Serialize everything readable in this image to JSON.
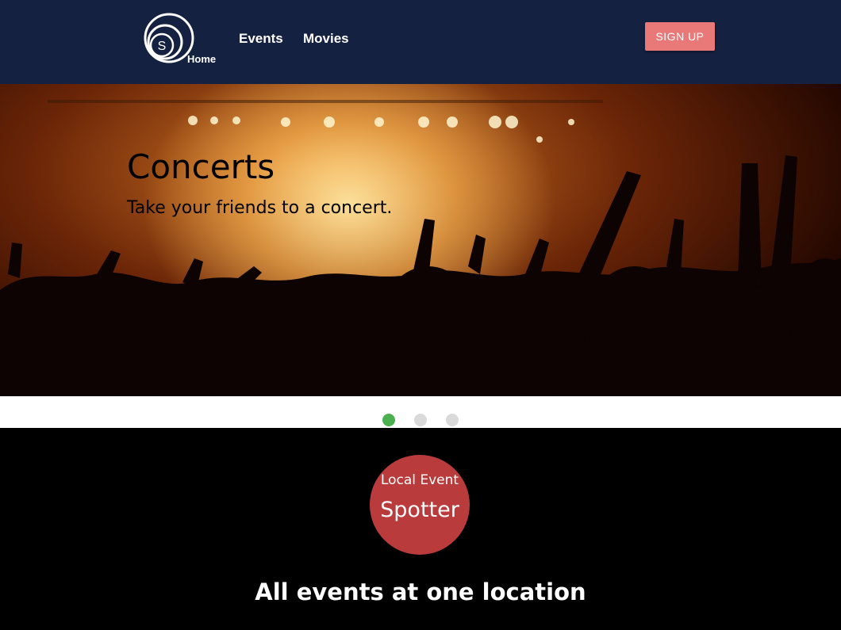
{
  "header": {
    "logo_letter": "S",
    "home_label": "Home",
    "nav": [
      {
        "label": "Events"
      },
      {
        "label": "Movies"
      }
    ],
    "signup_label": "SIGN UP"
  },
  "carousel": {
    "slides_count": 3,
    "active_index": 0,
    "slide": {
      "title": "Concerts",
      "subtitle": "Take your friends to a concert."
    },
    "colors": {
      "active_dot": "#4caf50",
      "inactive_dot": "#d9d9d9"
    }
  },
  "brand": {
    "badge_top": "Local Event",
    "badge_main": "Spotter",
    "tagline": "All events at one location",
    "badge_color": "#b93b3b"
  },
  "colors": {
    "navbar_bg": "#152140",
    "signup_bg": "#e97979"
  }
}
